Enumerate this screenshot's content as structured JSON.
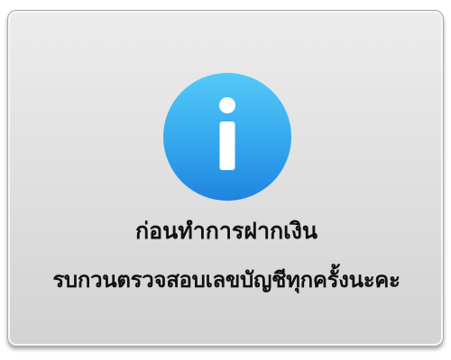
{
  "dialog": {
    "icon": "info-icon",
    "colors": {
      "icon_light": "#52c5f6",
      "icon_dark": "#1f86e0",
      "text": "#111111"
    },
    "message_line_1": "ก่อนทำการฝากเงิน",
    "message_line_2": "รบกวนตรวจสอบเลขบัญชีทุกครั้งนะคะ"
  }
}
